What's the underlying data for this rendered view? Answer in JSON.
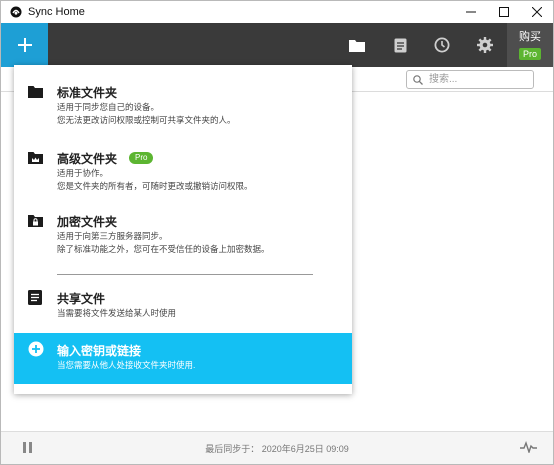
{
  "window": {
    "title": "Sync Home",
    "controls": [
      "minimize",
      "maximize",
      "close"
    ]
  },
  "toolbar": {
    "add_icon": "plus-icon",
    "tabs": [
      {
        "name": "folders",
        "icon": "folder-icon",
        "active": true
      },
      {
        "name": "history",
        "icon": "document-icon",
        "active": false
      },
      {
        "name": "clock",
        "icon": "clock-icon",
        "active": false
      },
      {
        "name": "settings",
        "icon": "gear-icon",
        "active": false
      }
    ],
    "buy_label": "购买",
    "buy_badge": "Pro"
  },
  "search": {
    "placeholder": "搜索..."
  },
  "menu": {
    "items": [
      {
        "title": "标准文件夹",
        "desc1": "适用于同步您自己的设备。",
        "desc2": "您无法更改访问权限或控制可共享文件夹的人。",
        "icon": "folder-icon"
      },
      {
        "title": "高级文件夹",
        "badge": "Pro",
        "desc1": "适用于协作。",
        "desc2": "您是文件夹的所有者，可随时更改或撤销访问权限。",
        "icon": "crown-folder-icon"
      },
      {
        "title": "加密文件夹",
        "desc1": "适用于向第三方服务器同步。",
        "desc2": "除了标准功能之外，您可在不受信任的设备上加密数据。",
        "icon": "lock-folder-icon"
      },
      {
        "title": "共享文件",
        "desc1": "当需要将文件发送给某人时使用",
        "icon": "file-icon"
      },
      {
        "title": "输入密钥或链接",
        "desc1": "当您需要从他人处接收文件夹时使用.",
        "icon": "plus-circle-icon",
        "highlighted": true
      }
    ]
  },
  "status": {
    "last_sync": "最后同步于： 2020年6月25日 09:09"
  },
  "colors": {
    "accent": "#1e9fd5",
    "highlight": "#14c0f3",
    "toolbar": "#3a3a3a",
    "pro": "#5cb531"
  }
}
